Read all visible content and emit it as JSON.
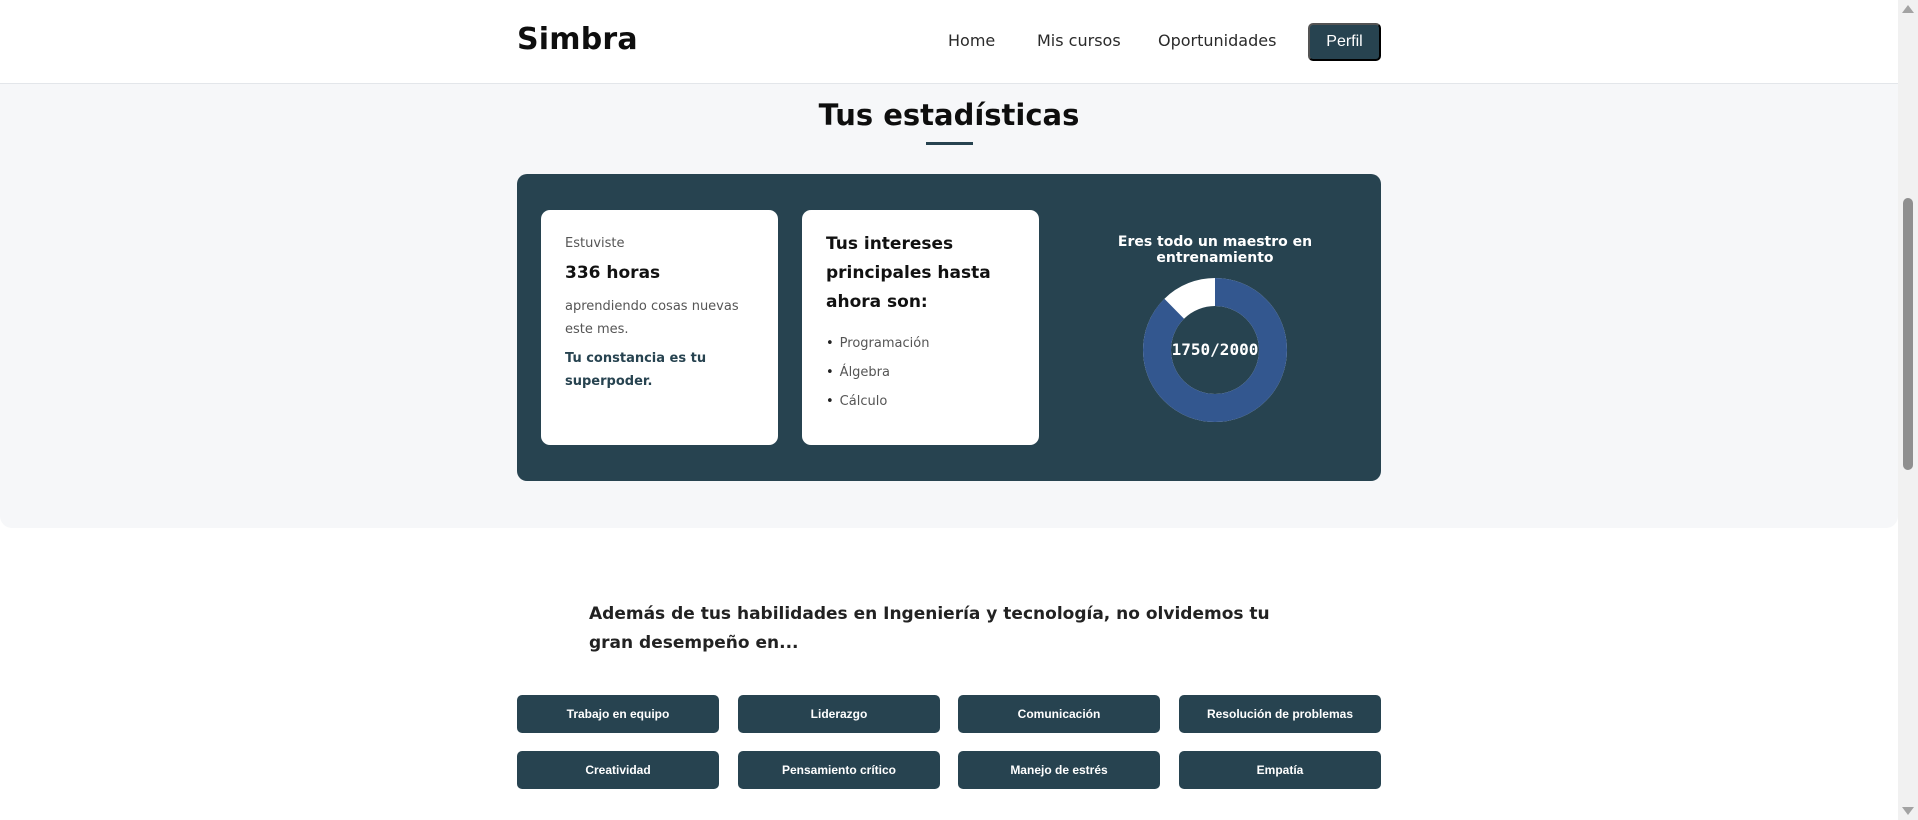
{
  "nav": {
    "brand": "Simbra",
    "links": [
      "Home",
      "Mis cursos",
      "Oportunidades"
    ],
    "profile_button": "Perfil"
  },
  "stats": {
    "title": "Tus estadísticas",
    "hours_card": {
      "intro": "Estuviste",
      "hours": "336 horas",
      "text": "aprendiendo cosas nuevas este mes.",
      "emphasis": "Tu constancia es tu superpoder."
    },
    "interests_card": {
      "title": "Tus intereses principales hasta ahora son:",
      "items": [
        "Programación",
        "Álgebra",
        "Cálculo"
      ]
    },
    "progress": {
      "caption": "Eres todo un maestro en entrenamiento",
      "label": "1750/2000",
      "value": 1750,
      "max": 2000,
      "fill_color": "#33578f",
      "rest_color": "#ffffff"
    }
  },
  "extra": {
    "heading": "Además de tus habilidades en Ingeniería y tecnología, no olvidemos tu gran desempeño en...",
    "skills": [
      "Trabajo en equipo",
      "Liderazgo",
      "Comunicación",
      "Resolución de problemas",
      "Creatividad",
      "Pensamiento crítico",
      "Manejo de estrés",
      "Empatía"
    ]
  },
  "colors": {
    "primary": "#274350",
    "background": "#f6f7f9"
  }
}
